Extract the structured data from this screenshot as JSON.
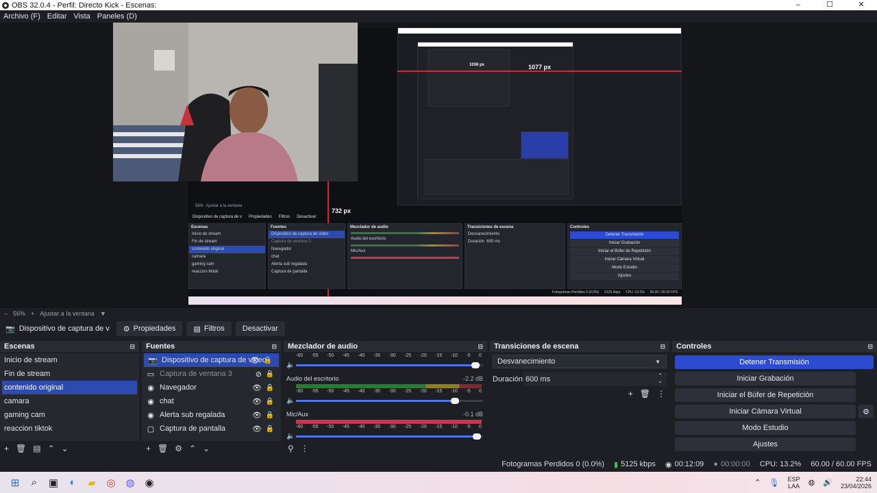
{
  "window": {
    "title": "OBS 32.0.4 - Perfil: Directo Kick - Escenas:",
    "minimize": "–",
    "maximize": "☐",
    "close": "✕"
  },
  "menu": [
    "Archivo (F)",
    "Editar",
    "Vista",
    "Paneles (D)"
  ],
  "preview": {
    "measure_h_label": "1077 px",
    "measure_v_label": "732 px",
    "inner_measure_label": "1036 px",
    "nested": {
      "toolbar_source": "Dispositivo de captura de v",
      "toolbar_props": "Propiedades",
      "toolbar_filters": "Filtros",
      "toolbar_deactivate": "Desactivar",
      "zoom": "56%",
      "fit": "Ajustar a la ventana",
      "scenes_hdr": "Escenas",
      "sources_hdr": "Fuentes",
      "mixer_hdr": "Mezclador de audio",
      "transitions_hdr": "Transiciones de escena",
      "controls_hdr": "Controles",
      "scenes": [
        "Inicio de stream",
        "Fin de stream",
        "contenido original",
        "camara",
        "gaming cam",
        "reaccion tiktok"
      ],
      "sources": [
        "Dispositivo de captura de video",
        "Captura de ventana 3",
        "Navegador",
        "chat",
        "Alerta sub regalada",
        "Captura de pantalla"
      ],
      "mixer_desktop": "Audio del escritorio",
      "mixer_mic": "Mic/Aux",
      "transition": "Desvanecimiento",
      "duration_label": "Duración",
      "duration": "600 ms",
      "controls": [
        "Detener Transmisión",
        "Iniciar Grabación",
        "Iniciar el Búfer de Repetición",
        "Iniciar Cámara Virtual",
        "Modo Estudio",
        "Ajustes"
      ],
      "status": "Fotogramas Perdidos 0 (0.0%)",
      "bitrate": "5125 kbps",
      "cpu": "CPU: 13.2%",
      "fps": "60.00 / 60.00 FPS"
    }
  },
  "zoombar": {
    "zoom_out": "–",
    "zoom": "56%",
    "zoom_in": "+",
    "fit": "Ajustar a la ventana"
  },
  "source_toolbar": {
    "source_name": "Dispositivo de captura de v",
    "properties": "Propiedades",
    "filters": "Filtros",
    "deactivate": "Desactivar"
  },
  "scenes": {
    "title": "Escenas",
    "items": [
      "Inicio de stream",
      "Fin de stream",
      "contenido original",
      "camara",
      "gaming cam",
      "reaccion tiktok"
    ],
    "selected_index": 2
  },
  "sources": {
    "title": "Fuentes",
    "items": [
      {
        "label": "Dispositivo de captura de video",
        "icon": "camera-icon"
      },
      {
        "label": "Captura de ventana 3",
        "icon": "window-icon"
      },
      {
        "label": "Navegador",
        "icon": "globe-icon"
      },
      {
        "label": "chat",
        "icon": "globe-icon"
      },
      {
        "label": "Alerta sub regalada",
        "icon": "globe-icon"
      },
      {
        "label": "Captura de pantalla",
        "icon": "monitor-icon"
      }
    ]
  },
  "mixer": {
    "title": "Mezclador de audio",
    "ticks": [
      "-60",
      "-55",
      "-50",
      "-45",
      "-40",
      "-35",
      "-30",
      "-25",
      "-20",
      "-15",
      "-10",
      "-5",
      "0"
    ],
    "channels": [
      {
        "name": "",
        "db": "",
        "volume": 0.98
      },
      {
        "name": "Audio del escritorio",
        "db": "-2.2 dB",
        "volume": 0.87
      },
      {
        "name": "Mic/Aux",
        "db": "-0.1 dB",
        "volume": 0.99
      }
    ]
  },
  "transitions": {
    "title": "Transiciones de escena",
    "selected": "Desvanecimiento",
    "duration_label": "Duración",
    "duration": "600 ms"
  },
  "controls": {
    "title": "Controles",
    "buttons": [
      "Detener Transmisión",
      "Iniciar Grabación",
      "Iniciar el Búfer de Repetición",
      "Iniciar Cámara Virtual",
      "Modo Estudio",
      "Ajustes"
    ]
  },
  "status": {
    "dropped": "Fotogramas Perdidos 0 (0.0%)",
    "bitrate": "5125 kbps",
    "stream_time": "00:12:09",
    "rec_time": "00:00:00",
    "cpu": "CPU: 13.2%",
    "fps": "60.00 / 60.00 FPS"
  },
  "taskbar": {
    "lang_top": "ESP",
    "lang_bottom": "LAA",
    "time": "22:44",
    "date": "23/04/2026"
  },
  "colors": {
    "accent_blue": "#2d4ab0",
    "stream_button": "#2c4bd0",
    "measure_red": "#d9263a"
  }
}
